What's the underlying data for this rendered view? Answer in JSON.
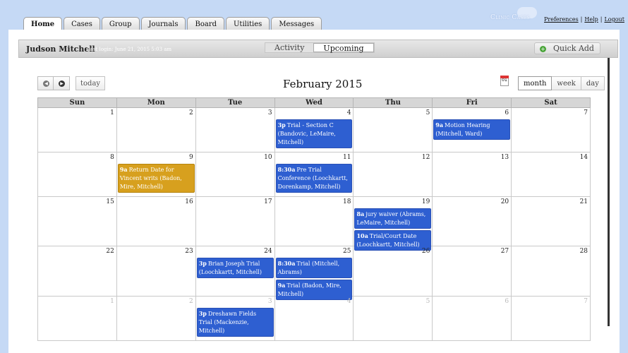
{
  "nav": {
    "tabs": [
      "Home",
      "Cases",
      "Group",
      "Journals",
      "Board",
      "Utilities",
      "Messages"
    ],
    "active": 0
  },
  "brand": {
    "name": "Clinic Cases"
  },
  "top_links": {
    "preferences": "Preferences",
    "help": "Help",
    "logout": "Logout",
    "separator": "|"
  },
  "header": {
    "user_name": "Judson Mitchell",
    "last_login": "Last login: June 21, 2015 5:03 am",
    "toggle": [
      "Activity",
      "Upcoming"
    ],
    "toggle_active": 1,
    "quick_add_icon": "+",
    "quick_add_label": "Quick Add"
  },
  "calendar": {
    "title": "February 2015",
    "today_label": "today",
    "prev_icon": "◀",
    "next_icon": "▶",
    "date_icon_text": "01",
    "views": [
      "month",
      "week",
      "day"
    ],
    "view_active": 0,
    "weekdays": [
      "Sun",
      "Mon",
      "Tue",
      "Wed",
      "Thu",
      "Fri",
      "Sat"
    ],
    "colors": {
      "event_blue": "#2e5fd1",
      "event_gold": "#d7a01e"
    },
    "weeks": [
      {
        "height": 63,
        "days": [
          {
            "n": "1",
            "other": false,
            "events": []
          },
          {
            "n": "2",
            "other": false,
            "events": []
          },
          {
            "n": "3",
            "other": false,
            "events": []
          },
          {
            "n": "4",
            "other": false,
            "events": [
              {
                "time": "3p",
                "title": "Trial - Section C (Bandovic, LeMaire, Mitchell)",
                "color": "#2e5fd1"
              }
            ]
          },
          {
            "n": "5",
            "other": false,
            "events": []
          },
          {
            "n": "6",
            "other": false,
            "events": [
              {
                "time": "9a",
                "title": "Motion Hearing (Mitchell, Ward)",
                "color": "#2e5fd1"
              }
            ]
          },
          {
            "n": "7",
            "other": false,
            "events": []
          }
        ]
      },
      {
        "height": 63,
        "days": [
          {
            "n": "8",
            "other": false,
            "events": []
          },
          {
            "n": "9",
            "other": false,
            "events": [
              {
                "time": "9a",
                "title": "Return Date for Vincent writs (Badon, Mire, Mitchell)",
                "color": "#d7a01e"
              }
            ]
          },
          {
            "n": "10",
            "other": false,
            "events": []
          },
          {
            "n": "11",
            "other": false,
            "events": [
              {
                "time": "8:30a",
                "title": "Pre Trial Conference (Loochkartt, Dorenkamp, Mitchell)",
                "color": "#2e5fd1"
              }
            ]
          },
          {
            "n": "12",
            "other": false,
            "events": []
          },
          {
            "n": "13",
            "other": false,
            "events": []
          },
          {
            "n": "14",
            "other": false,
            "events": []
          }
        ]
      },
      {
        "height": 70,
        "days": [
          {
            "n": "15",
            "other": false,
            "events": []
          },
          {
            "n": "16",
            "other": false,
            "events": []
          },
          {
            "n": "17",
            "other": false,
            "events": []
          },
          {
            "n": "18",
            "other": false,
            "events": []
          },
          {
            "n": "19",
            "other": false,
            "events": [
              {
                "time": "8a",
                "title": "jury waiver (Abrams, LeMaire, Mitchell)",
                "color": "#2e5fd1"
              },
              {
                "time": "10a",
                "title": "Trial/Court Date (Loochkartt, Mitchell)",
                "color": "#2e5fd1"
              }
            ]
          },
          {
            "n": "20",
            "other": false,
            "events": []
          },
          {
            "n": "21",
            "other": false,
            "events": []
          }
        ]
      },
      {
        "height": 71,
        "days": [
          {
            "n": "22",
            "other": false,
            "events": []
          },
          {
            "n": "23",
            "other": false,
            "events": []
          },
          {
            "n": "24",
            "other": false,
            "events": [
              {
                "time": "3p",
                "title": "Brian Joseph Trial (Loochkartt, Mitchell)",
                "color": "#2e5fd1"
              }
            ]
          },
          {
            "n": "25",
            "other": false,
            "events": [
              {
                "time": "8:30a",
                "title": "Trial (Mitchell, Abrams)",
                "color": "#2e5fd1"
              },
              {
                "time": "9a",
                "title": "Trial (Badon, Mire, Mitchell)",
                "color": "#2e5fd1"
              }
            ]
          },
          {
            "n": "26",
            "other": false,
            "events": []
          },
          {
            "n": "27",
            "other": false,
            "events": []
          },
          {
            "n": "28",
            "other": false,
            "events": []
          }
        ]
      },
      {
        "height": 63,
        "days": [
          {
            "n": "1",
            "other": true,
            "events": []
          },
          {
            "n": "2",
            "other": true,
            "events": []
          },
          {
            "n": "3",
            "other": true,
            "events": [
              {
                "time": "3p",
                "title": "Dreshawn Fields Trial (Mackenzie, Mitchell)",
                "color": "#2e5fd1"
              }
            ]
          },
          {
            "n": "4",
            "other": true,
            "events": []
          },
          {
            "n": "5",
            "other": true,
            "events": []
          },
          {
            "n": "6",
            "other": true,
            "events": []
          },
          {
            "n": "7",
            "other": true,
            "events": []
          }
        ]
      }
    ]
  }
}
